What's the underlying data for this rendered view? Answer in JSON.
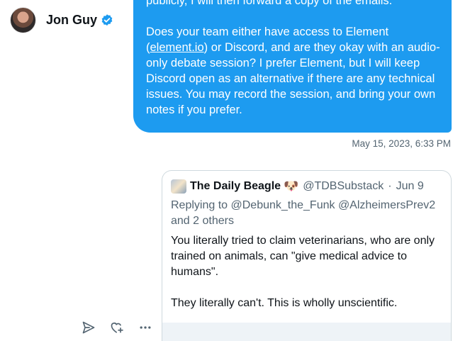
{
  "header": {
    "name": "Jon Guy"
  },
  "message": {
    "paragraph1": "publicly, I will then forward a copy of the emails.",
    "paragraph2_pre": "Does your team either have access to Element (",
    "link_text": "element.io",
    "paragraph2_post": ") or Discord, and are they okay with an audio-only debate session? I prefer Element, but I will keep Discord open as an alternative if there are any technical issues. You may record the session, and bring your own notes if you prefer.",
    "timestamp": "May 15, 2023, 6:33 PM"
  },
  "quoted_post": {
    "display_name": "The Daily Beagle",
    "emoji": "🐶",
    "handle": "@TDBSubstack",
    "separator": "·",
    "date": "Jun 9",
    "replying_to": "Replying to @Debunk_the_Funk @AlzheimersPrev2 and 2 others",
    "body_line1": "You literally tried to claim veterinarians, who are only trained on animals, can \"give medical advice to humans\".",
    "body_line2": "They literally can't. This is wholly unscientific."
  },
  "colors": {
    "bubble": "#1d9bf0",
    "secondary_text": "#536471",
    "verified": "#1d9bf0"
  },
  "icons": {
    "info": "info-icon",
    "verified": "verified-badge-icon",
    "send": "send-icon",
    "react": "heart-plus-icon",
    "more": "more-icon"
  }
}
